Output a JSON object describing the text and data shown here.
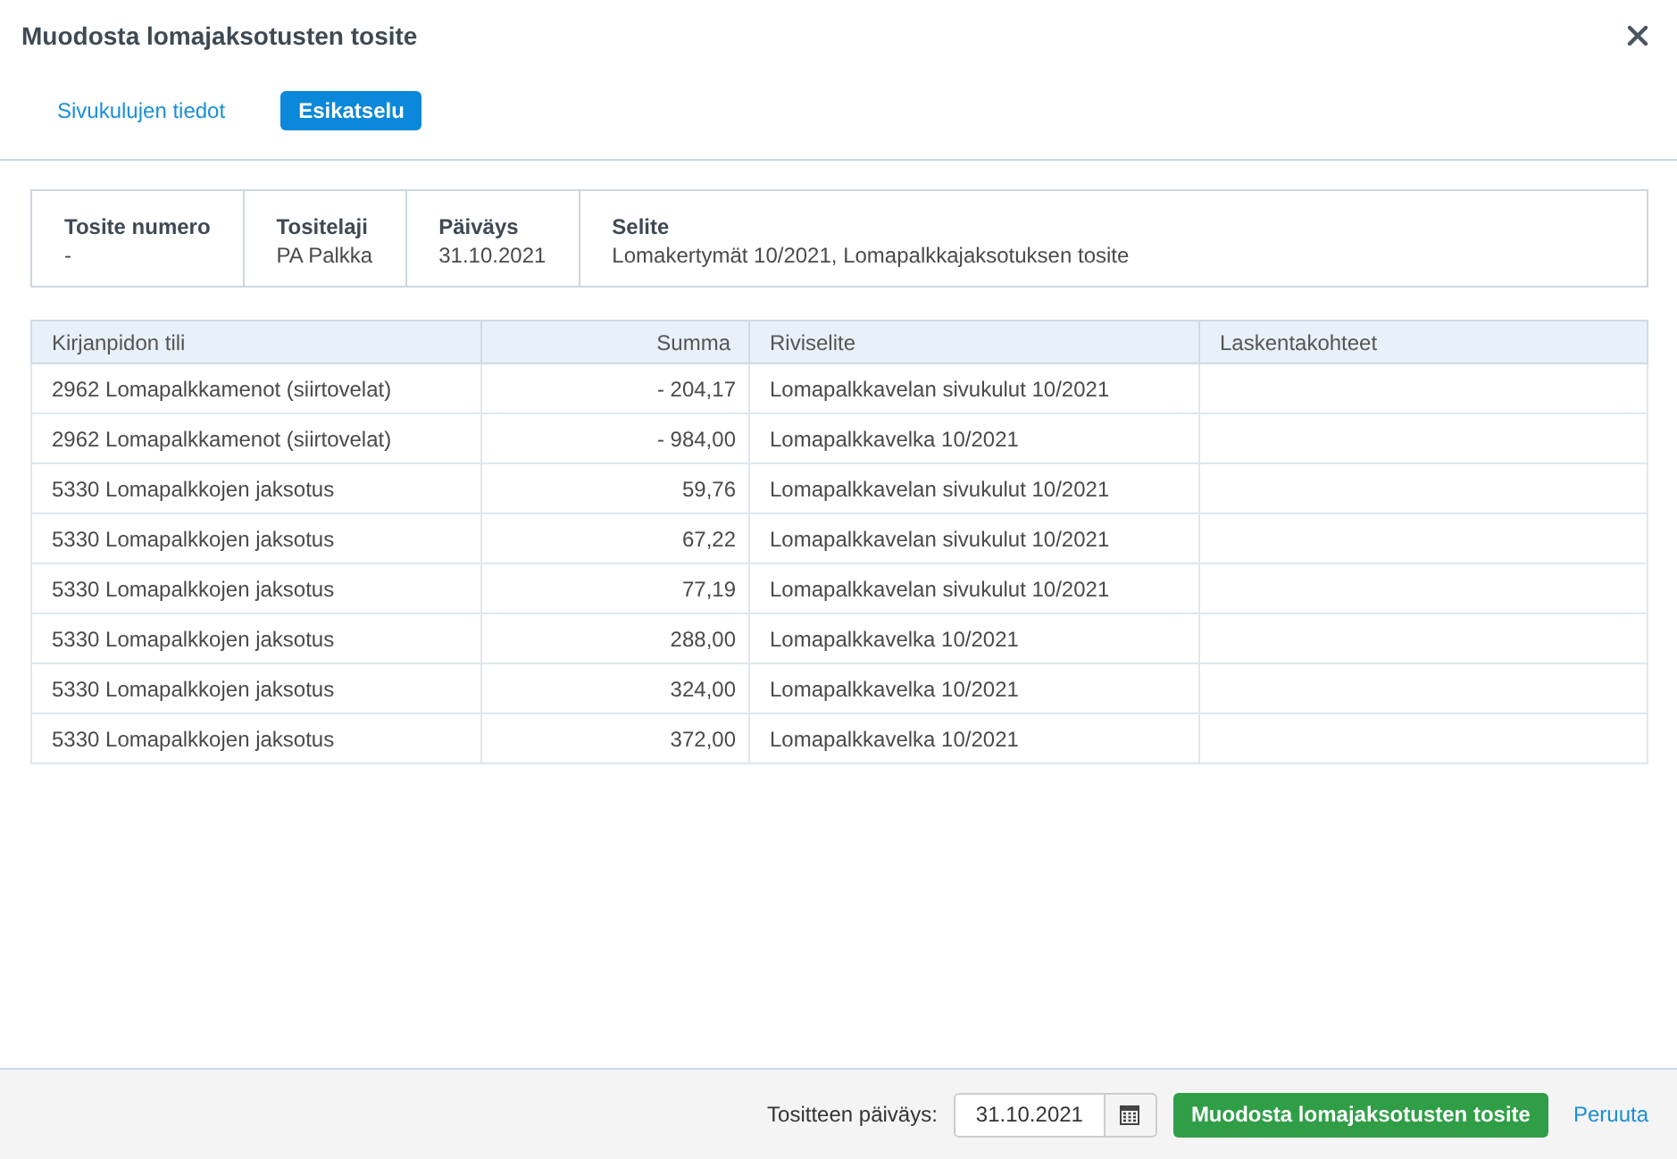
{
  "dialog": {
    "title": "Muodosta lomajaksotusten tosite"
  },
  "tabs": [
    {
      "label": "Sivukulujen tiedot",
      "selected": false
    },
    {
      "label": "Esikatselu",
      "selected": true
    }
  ],
  "summary": [
    {
      "label": "Tosite numero",
      "value": "-"
    },
    {
      "label": "Tositelaji",
      "value": "PA Palkka"
    },
    {
      "label": "Päiväys",
      "value": "31.10.2021"
    },
    {
      "label": "Selite",
      "value": "Lomakertymät 10/2021, Lomapalkkajaksotuksen tosite"
    }
  ],
  "table": {
    "columns": [
      "Kirjanpidon tili",
      "Summa",
      "Riviselite",
      "Laskentakohteet"
    ],
    "rows": [
      {
        "account": "2962 Lomapalkkamenot (siirtovelat)",
        "amount": "- 204,17",
        "description": "Lomapalkkavelan sivukulut 10/2021"
      },
      {
        "account": "2962 Lomapalkkamenot (siirtovelat)",
        "amount": "- 984,00",
        "description": "Lomapalkkavelka 10/2021"
      },
      {
        "account": "5330 Lomapalkkojen jaksotus",
        "amount": "59,76",
        "description": "Lomapalkkavelan sivukulut 10/2021"
      },
      {
        "account": "5330 Lomapalkkojen jaksotus",
        "amount": "67,22",
        "description": "Lomapalkkavelan sivukulut 10/2021"
      },
      {
        "account": "5330 Lomapalkkojen jaksotus",
        "amount": "77,19",
        "description": "Lomapalkkavelan sivukulut 10/2021"
      },
      {
        "account": "5330 Lomapalkkojen jaksotus",
        "amount": "288,00",
        "description": "Lomapalkkavelka 10/2021"
      },
      {
        "account": "5330 Lomapalkkojen jaksotus",
        "amount": "324,00",
        "description": "Lomapalkkavelka 10/2021"
      },
      {
        "account": "5330 Lomapalkkojen jaksotus",
        "amount": "372,00",
        "description": "Lomapalkkavelka 10/2021"
      }
    ]
  },
  "footer": {
    "date_label": "Tositteen päiväys:",
    "date_value": "31.10.2021",
    "submit": "Muodosta lomajaksotusten tosite",
    "cancel": "Peruuta"
  }
}
